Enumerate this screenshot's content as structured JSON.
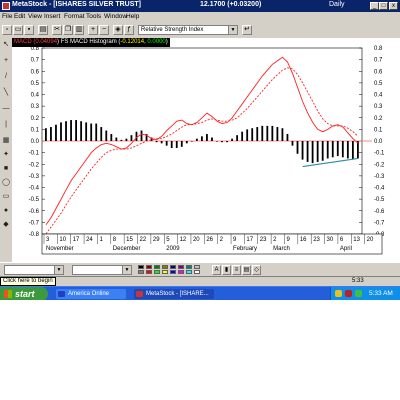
{
  "window": {
    "app_name": "MetaStock",
    "title": "MetaStock - [ISHARES SILVER TRUST]",
    "price_display": "12.1700 (+0.03200)",
    "period": "Daily",
    "min_label": "_",
    "max_label": "□",
    "close_label": "x"
  },
  "menu": [
    "File",
    "Edit",
    "View",
    "Insert",
    "Format",
    "Tools",
    "Window",
    "Help"
  ],
  "toolbar": {
    "indicator_select": "Relative Strength Index",
    "dropdown_arrow": "▼"
  },
  "left_tools": [
    "↖",
    "+",
    "/",
    "╲",
    "—",
    "|",
    "▦",
    "✦",
    "■",
    "◯",
    "▭",
    "●",
    "◆"
  ],
  "chart_header": {
    "name_prefix": "MACD (",
    "name_value": "0.04094",
    "histogram_label": ") FS MACD Histogram (",
    "hist_value_1": "-0.12014",
    "hist_value_2": "0.0000",
    "close_paren": ")",
    "colors": {
      "prefix": "#ff4040",
      "value": "#ff4040",
      "hist": "#ffffff",
      "hist_v1": "#ffff00",
      "hist_v2": "#00ff00"
    }
  },
  "chart_data": {
    "type": "line",
    "title": "",
    "ylim": [
      -0.8,
      0.8
    ],
    "yticks": [
      "0.8",
      "0.7",
      "0.6",
      "0.5",
      "0.4",
      "0.3",
      "0.2",
      "0.1",
      "0.0",
      "-0.1",
      "-0.2",
      "-0.3",
      "-0.4",
      "-0.5",
      "-0.6",
      "-0.7",
      "-0.8"
    ],
    "ytick_values": [
      0.8,
      0.7,
      0.6,
      0.5,
      0.4,
      0.3,
      0.2,
      0.1,
      0.0,
      -0.1,
      -0.2,
      -0.3,
      -0.4,
      -0.5,
      -0.6,
      -0.7,
      -0.8
    ],
    "x_day_labels": [
      "3",
      "10",
      "17",
      "24",
      "1",
      "8",
      "15",
      "22",
      "29",
      "5",
      "12",
      "20",
      "26",
      "2",
      "9",
      "17",
      "23",
      "2",
      "9",
      "16",
      "23",
      "30",
      "6",
      "13",
      "20"
    ],
    "x_month_labels": [
      "November",
      "December",
      "2009",
      "February",
      "March",
      "April"
    ],
    "series": [
      {
        "name": "MACD",
        "color": "#ff2020",
        "style": "solid",
        "values": [
          -0.72,
          -0.66,
          -0.58,
          -0.5,
          -0.42,
          -0.34,
          -0.28,
          -0.22,
          -0.16,
          -0.1,
          -0.06,
          -0.03,
          -0.02,
          -0.03,
          -0.05,
          -0.07,
          -0.06,
          -0.02,
          0.03,
          0.06,
          0.05,
          0.02,
          0.01,
          0.04,
          0.09,
          0.13,
          0.17,
          0.18,
          0.15,
          0.14,
          0.16,
          0.2,
          0.24,
          0.21,
          0.17,
          0.15,
          0.16,
          0.2,
          0.26,
          0.32,
          0.38,
          0.44,
          0.5,
          0.56,
          0.61,
          0.66,
          0.69,
          0.72,
          0.68,
          0.58,
          0.46,
          0.34,
          0.24,
          0.16,
          0.1,
          0.08,
          0.1,
          0.13,
          0.14,
          0.12,
          0.07,
          0.02,
          -0.02
        ]
      },
      {
        "name": "Signal",
        "color": "#ff2020",
        "style": "dotted",
        "values": [
          -0.8,
          -0.74,
          -0.68,
          -0.62,
          -0.55,
          -0.48,
          -0.42,
          -0.36,
          -0.3,
          -0.24,
          -0.19,
          -0.14,
          -0.1,
          -0.08,
          -0.07,
          -0.07,
          -0.07,
          -0.06,
          -0.04,
          -0.02,
          0.0,
          0.01,
          0.02,
          0.02,
          0.04,
          0.06,
          0.09,
          0.12,
          0.14,
          0.14,
          0.15,
          0.16,
          0.18,
          0.19,
          0.18,
          0.17,
          0.17,
          0.18,
          0.2,
          0.24,
          0.28,
          0.33,
          0.38,
          0.43,
          0.48,
          0.53,
          0.57,
          0.61,
          0.63,
          0.62,
          0.57,
          0.5,
          0.42,
          0.34,
          0.26,
          0.19,
          0.15,
          0.13,
          0.13,
          0.13,
          0.11,
          0.08,
          0.04
        ]
      },
      {
        "name": "Histogram",
        "color": "#000000",
        "style": "bar",
        "values": [
          0.11,
          0.12,
          0.14,
          0.16,
          0.17,
          0.18,
          0.18,
          0.17,
          0.16,
          0.15,
          0.15,
          0.12,
          0.09,
          0.06,
          0.03,
          0.01,
          0.02,
          0.05,
          0.08,
          0.09,
          0.06,
          0.03,
          -0.01,
          -0.02,
          -0.04,
          -0.06,
          -0.06,
          -0.05,
          -0.02,
          0.0,
          0.02,
          0.04,
          0.06,
          0.03,
          0.0,
          -0.01,
          -0.01,
          0.02,
          0.05,
          0.08,
          0.1,
          0.11,
          0.12,
          0.13,
          0.13,
          0.13,
          0.12,
          0.11,
          0.06,
          -0.04,
          -0.11,
          -0.16,
          -0.18,
          -0.19,
          -0.18,
          -0.17,
          -0.15,
          -0.14,
          -0.13,
          -0.14,
          -0.15,
          -0.16,
          -0.15
        ]
      }
    ],
    "trendline": {
      "color": "#2a8aa8",
      "from": [
        51,
        -0.22
      ],
      "to": [
        62,
        -0.15
      ]
    },
    "zero_line_color": "#ff6060",
    "grid": false
  },
  "bottom_bar": {
    "colors": [
      "#000000",
      "#800000",
      "#008000",
      "#808000",
      "#000080",
      "#800080",
      "#008080",
      "#c0c0c0",
      "#808080",
      "#ff0000",
      "#00ff00",
      "#ffff00",
      "#0000ff",
      "#ff00ff",
      "#00ffff",
      "#ffffff"
    ],
    "buttons": [
      "A",
      "▮",
      "≡",
      "▤",
      "◇"
    ]
  },
  "status": {
    "hint": "Click here to begin",
    "time": "5:33"
  },
  "taskbar": {
    "start_label": "start",
    "tasks": [
      "America Online",
      "MetaStock - [ISHARE..."
    ],
    "clock": "5:33 AM"
  }
}
